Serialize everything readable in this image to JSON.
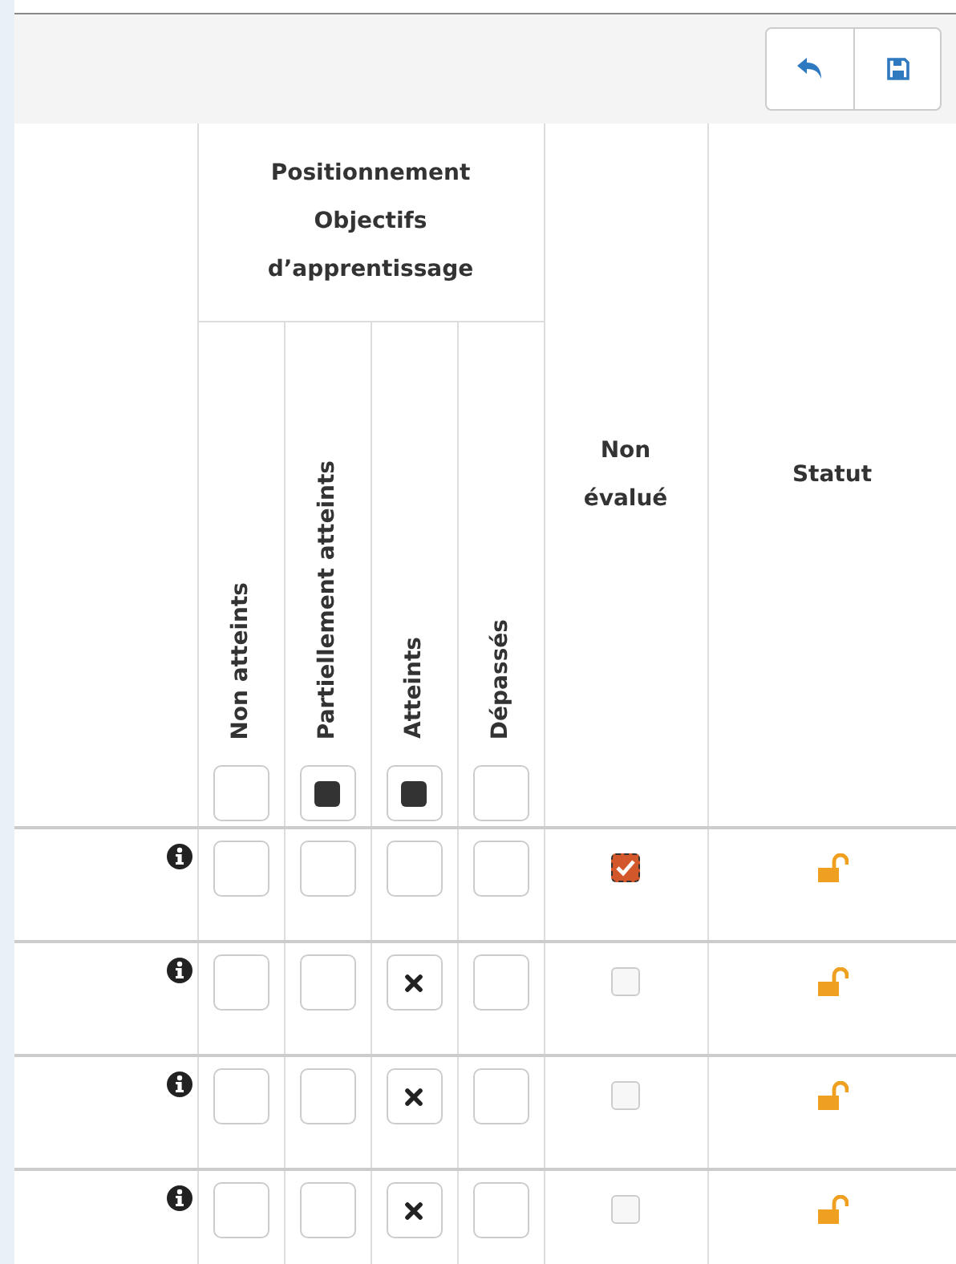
{
  "toolbar": {
    "buttons": [
      {
        "kind": "undo"
      },
      {
        "kind": "save"
      }
    ]
  },
  "table": {
    "group_heading": "Positionnement Objectifs d’apprentissage",
    "levels": [
      {
        "label": "Non atteints",
        "filled": false
      },
      {
        "label": "Partiellement atteints",
        "filled": true
      },
      {
        "label": "Atteints",
        "filled": true
      },
      {
        "label": "Dépassés",
        "filled": false
      }
    ],
    "not_evaluated_heading": "Non évalué",
    "status_heading": "Statut",
    "rows": [
      {
        "marks": [
          false,
          false,
          false,
          false
        ],
        "not_evaluated": true,
        "locked": false
      },
      {
        "marks": [
          false,
          false,
          true,
          false
        ],
        "not_evaluated": false,
        "locked": false
      },
      {
        "marks": [
          false,
          false,
          true,
          false
        ],
        "not_evaluated": false,
        "locked": false
      },
      {
        "marks": [
          false,
          false,
          true,
          false
        ],
        "not_evaluated": false,
        "locked": false
      }
    ]
  }
}
